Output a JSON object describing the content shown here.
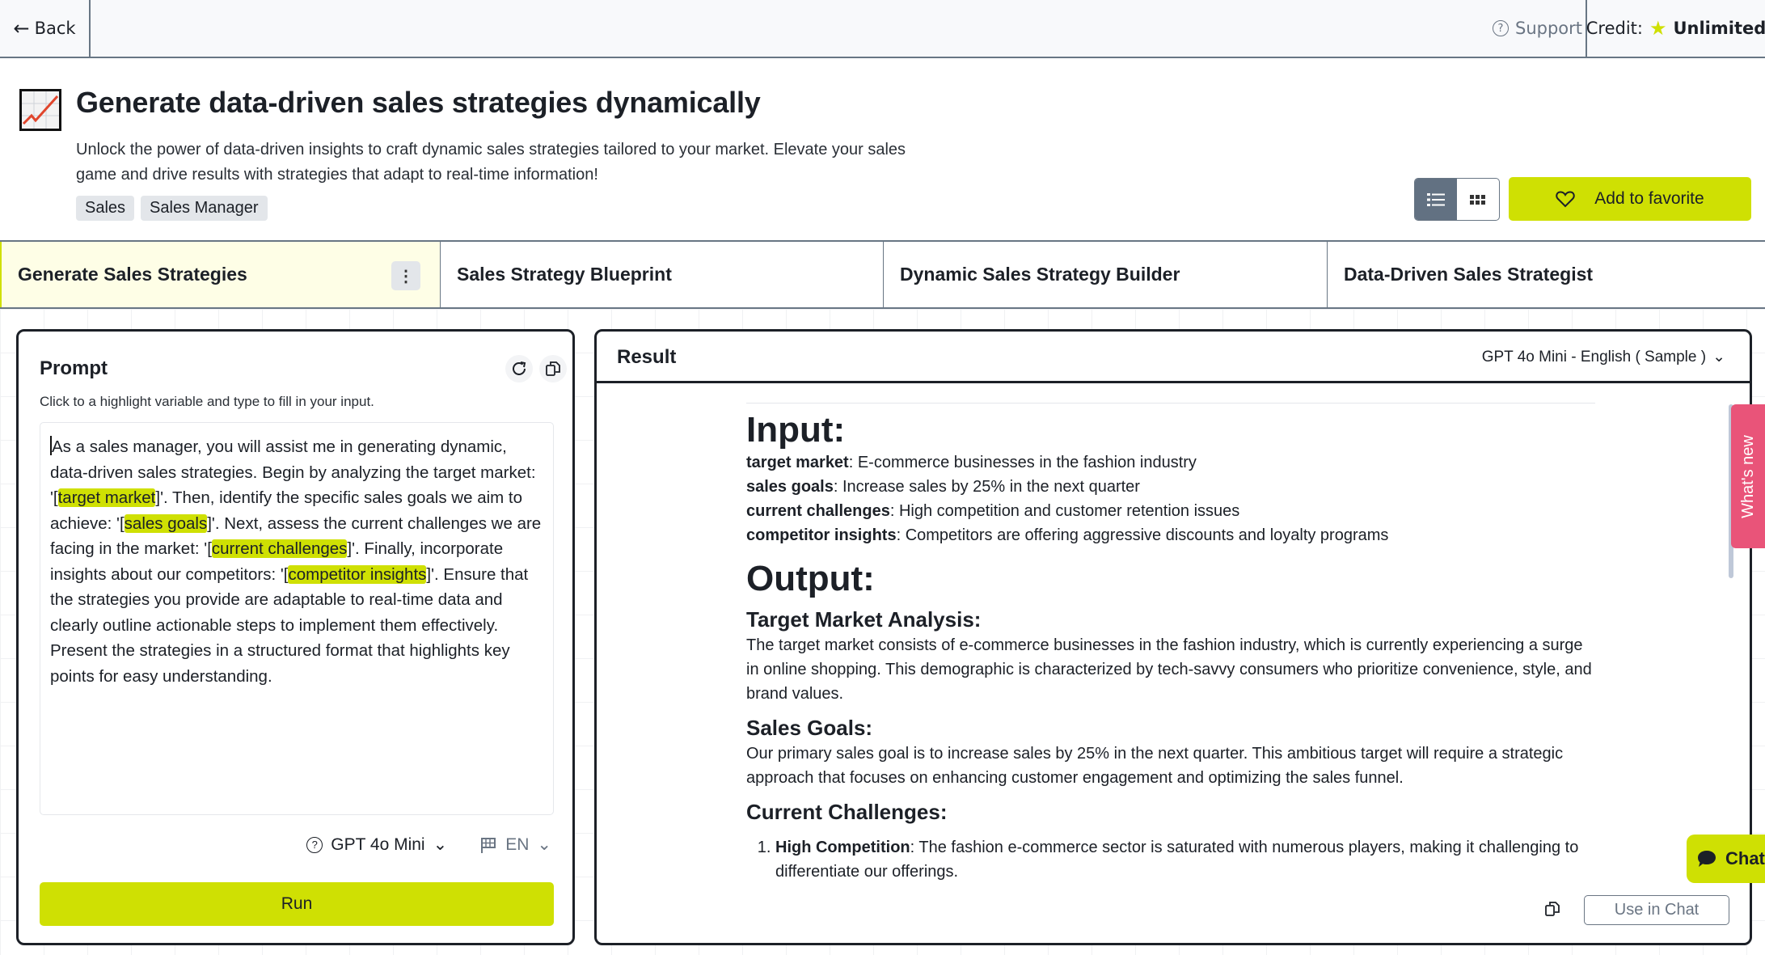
{
  "topbar": {
    "back_label": "Back",
    "support_label": "Support",
    "credit_label": "Credit:",
    "credit_value": "Unlimited"
  },
  "header": {
    "icon": "chart-increasing-icon",
    "title": "Generate data-driven sales strategies dynamically",
    "description": "Unlock the power of data-driven insights to craft dynamic sales strategies tailored to your market. Elevate your sales game and drive results with strategies that adapt to real-time information!",
    "tags": [
      "Sales",
      "Sales Manager"
    ],
    "view_modes": [
      "list",
      "grid"
    ],
    "active_view": "list",
    "favorite_label": "Add to favorite"
  },
  "tabs": [
    {
      "label": "Generate Sales Strategies",
      "active": true
    },
    {
      "label": "Sales Strategy Blueprint",
      "active": false
    },
    {
      "label": "Dynamic Sales Strategy Builder",
      "active": false
    },
    {
      "label": "Data-Driven Sales Strategist",
      "active": false
    }
  ],
  "prompt": {
    "title": "Prompt",
    "hint": "Click to a highlight variable and type to fill in your input.",
    "segments": [
      {
        "text": "As a sales manager, you will assist me in generating dynamic, data-driven sales strategies. Begin by analyzing the target market: '[",
        "var": false
      },
      {
        "text": "target market",
        "var": true
      },
      {
        "text": "]'. Then, identify the specific sales goals we aim to achieve: '[",
        "var": false
      },
      {
        "text": "sales goals",
        "var": true
      },
      {
        "text": "]'. Next, assess the current challenges we are facing in the market: '[",
        "var": false
      },
      {
        "text": "current challenges",
        "var": true
      },
      {
        "text": "]'. Finally, incorporate insights about our competitors: '[",
        "var": false
      },
      {
        "text": "competitor insights",
        "var": true
      },
      {
        "text": "]'. Ensure that the strategies you provide are adaptable to real-time data and clearly outline actionable steps to implement them effectively. Present the strategies in a structured format that highlights key points for easy understanding.",
        "var": false
      }
    ],
    "model": "GPT 4o Mini",
    "language": "EN",
    "run_label": "Run"
  },
  "result": {
    "title": "Result",
    "model_selector": "GPT 4o Mini - English ( Sample )",
    "input_heading": "Input:",
    "inputs": [
      {
        "key": "target market",
        "value": "E-commerce businesses in the fashion industry"
      },
      {
        "key": "sales goals",
        "value": "Increase sales by 25% in the next quarter"
      },
      {
        "key": "current challenges",
        "value": "High competition and customer retention issues"
      },
      {
        "key": "competitor insights",
        "value": "Competitors are offering aggressive discounts and loyalty programs"
      }
    ],
    "output_heading": "Output:",
    "sections": [
      {
        "heading": "Target Market Analysis:",
        "text": "The target market consists of e-commerce businesses in the fashion industry, which is currently experiencing a surge in online shopping. This demographic is characterized by tech-savvy consumers who prioritize convenience, style, and brand values."
      },
      {
        "heading": "Sales Goals:",
        "text": "Our primary sales goal is to increase sales by 25% in the next quarter. This ambitious target will require a strategic approach that focuses on enhancing customer engagement and optimizing the sales funnel."
      },
      {
        "heading": "Current Challenges:",
        "text": ""
      }
    ],
    "challenges": [
      {
        "title": "High Competition",
        "text": "The fashion e-commerce sector is saturated with numerous players, making it challenging to differentiate our offerings."
      }
    ],
    "use_in_chat_label": "Use in Chat"
  },
  "floating": {
    "whats_new_label": "What's new",
    "chat_label": "Chat"
  },
  "colors": {
    "accent": "#cfe003",
    "whats_new": "#e95479",
    "border": "#687684"
  }
}
